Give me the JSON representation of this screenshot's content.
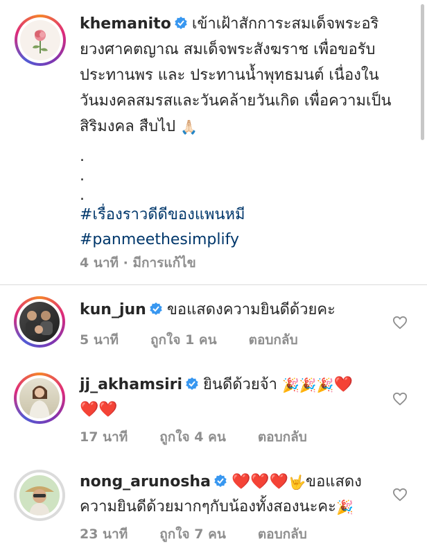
{
  "post": {
    "username": "khemanito",
    "caption": "เข้าเฝ้าสักการะสมเด็จพระอริยวงศาคตญาณ สมเด็จพระสังฆราช  เพื่อขอรับประทานพร และ ประทานน้ำพุทธมนต์ เนื่องในวันมงคลสมรสและวันคล้ายวันเกิด เพื่อความเป็นสิริมงคล สืบไป",
    "caption_emoji": "🙏🏻",
    "dots": [
      ".",
      ".",
      "."
    ],
    "hashtags": [
      "#เรื่องราวดีดีของแพนหมี",
      "#panmeethesimplify"
    ],
    "time": "4 นาที",
    "edited": "มีการแก้ไข",
    "separator": " · "
  },
  "comments": [
    {
      "username": "kun_jun",
      "text": "ขอแสดงความยินดีด้วยคะ",
      "time": "5 นาที",
      "likes": "ถูกใจ 1 คน",
      "reply": "ตอบกลับ"
    },
    {
      "username": "jj_akhamsiri",
      "text": "ยินดีด้วยจ้า",
      "emojis": "🎉🎉🎉",
      "hearts_inline": "❤️",
      "hearts_line2": "❤️❤️",
      "time": "17 นาที",
      "likes": "ถูกใจ 4 คน",
      "reply": "ตอบกลับ"
    },
    {
      "username": "nong_arunosha",
      "hearts": "❤️❤️❤️",
      "hand": "🤟",
      "text": "ขอแสดงความยินดีด้วยมากๆกับน้องทั้งสองนะคะ",
      "emoji_end": "🎉",
      "time": "23 นาที",
      "likes": "ถูกใจ 7 คน",
      "reply": "ตอบกลับ"
    }
  ],
  "colors": {
    "verified": "#3897f0",
    "link": "#00376b",
    "meta": "#8e8e8e",
    "heart": "#e0245e"
  }
}
